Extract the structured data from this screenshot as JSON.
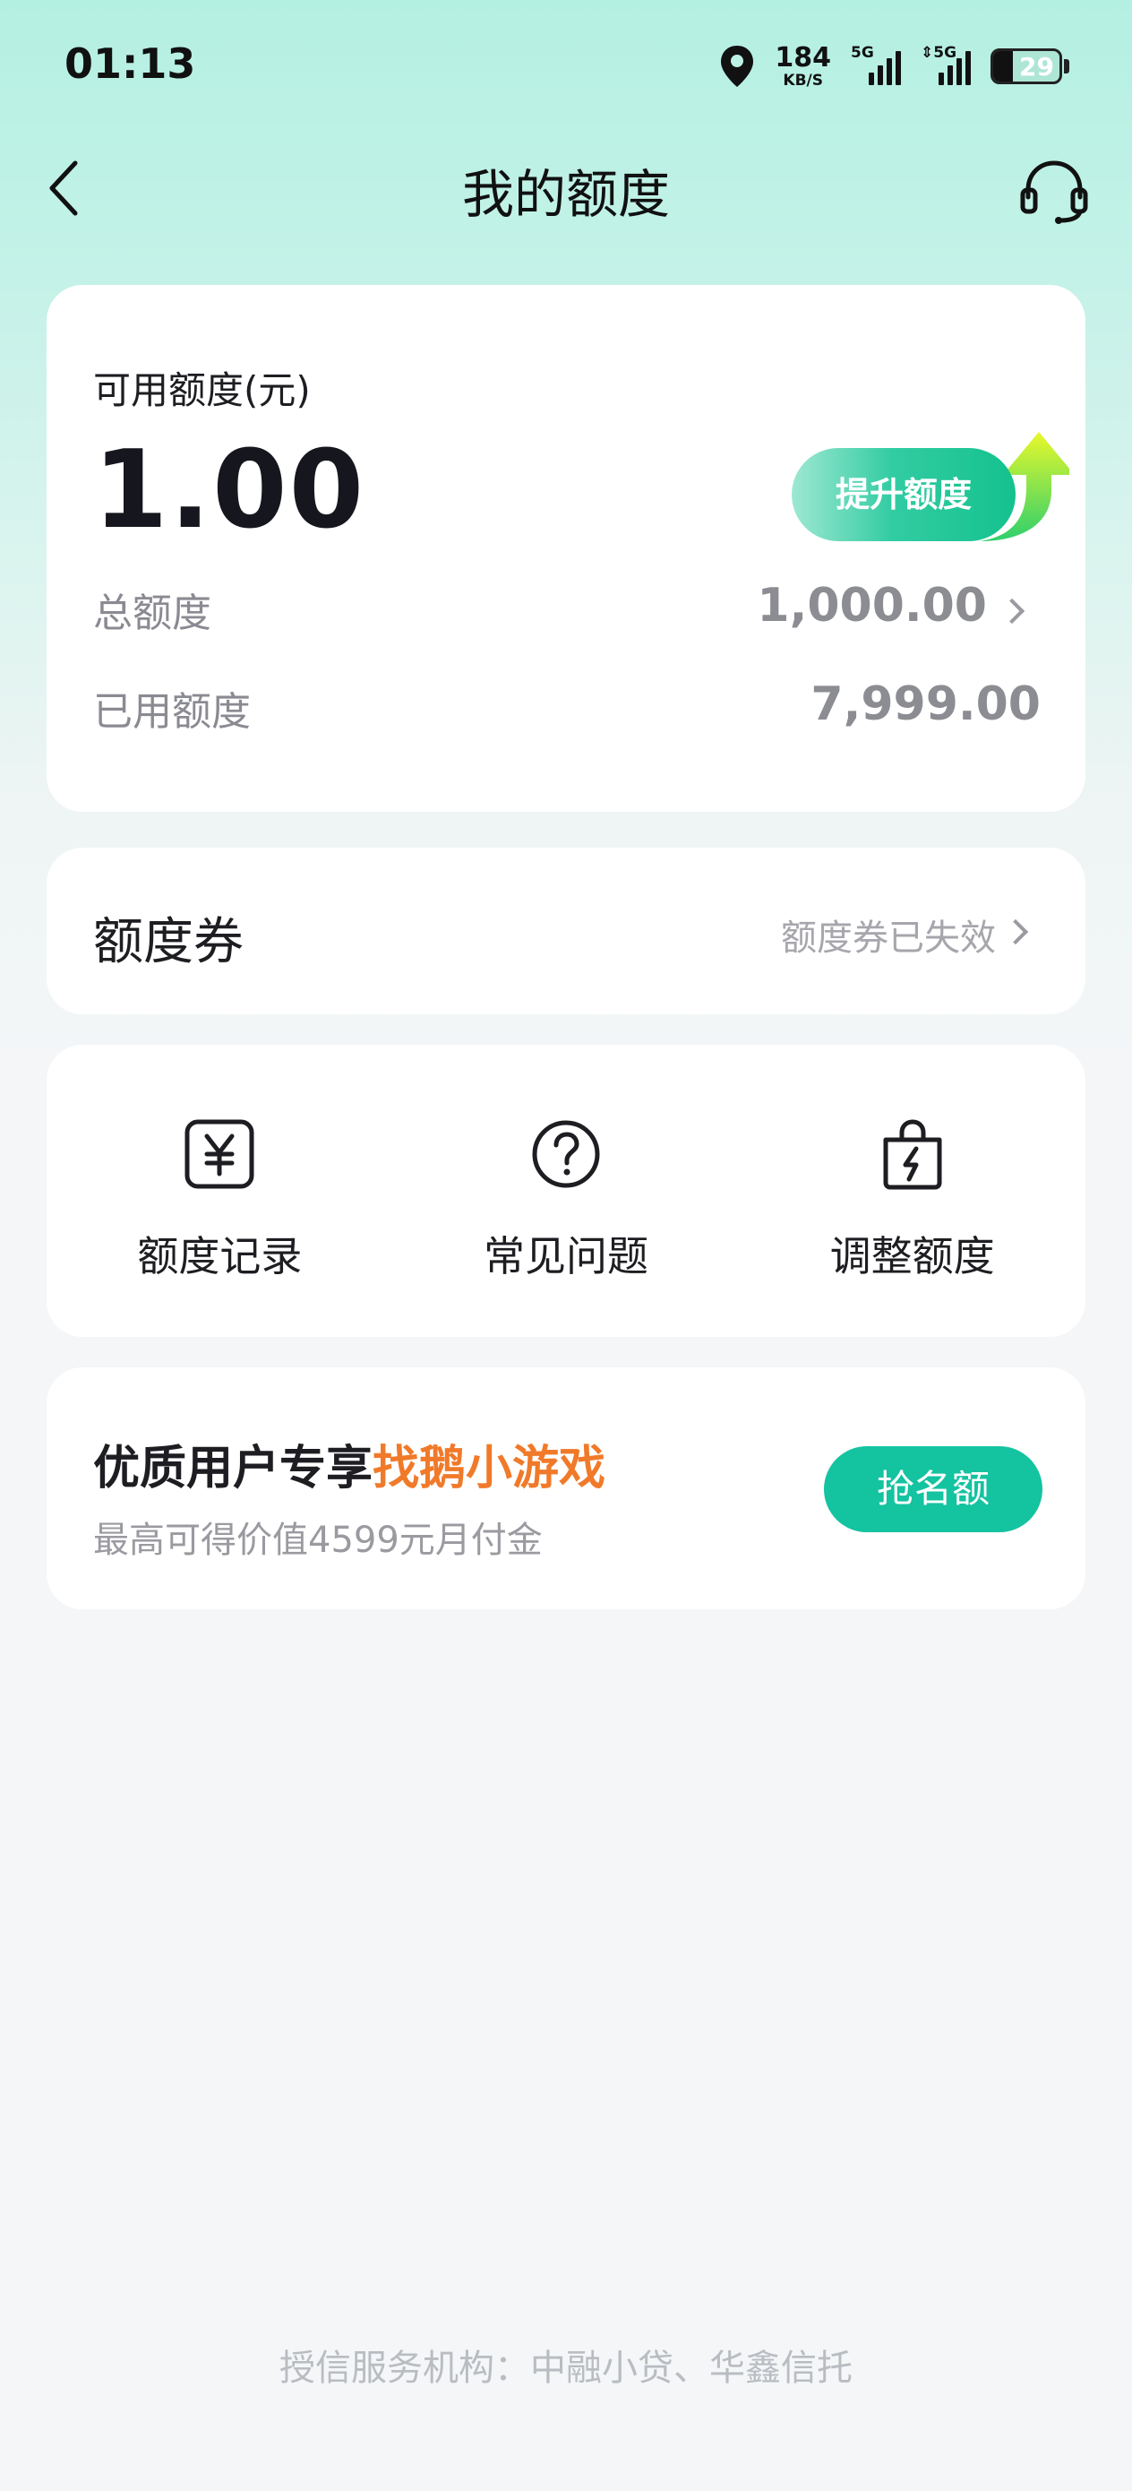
{
  "status_bar": {
    "time": "01:13",
    "net_speed_value": "184",
    "net_speed_unit": "KB/S",
    "sim1_tag": "5G",
    "sim2_tag": "⇕5G",
    "battery_level": "29"
  },
  "nav": {
    "title": "我的额度"
  },
  "quota": {
    "available_label": "可用额度(元)",
    "available_amount": "1.00",
    "raise_label": "提升额度",
    "total_label": "总额度",
    "total_value": "1,000.00",
    "used_label": "已用额度",
    "used_value": "7,999.00"
  },
  "coupon": {
    "title": "额度券",
    "status": "额度券已失效"
  },
  "entries": [
    {
      "label": "额度记录",
      "icon": "yuan-record-icon"
    },
    {
      "label": "常见问题",
      "icon": "question-circle-icon"
    },
    {
      "label": "调整额度",
      "icon": "bag-lightning-icon"
    }
  ],
  "promo": {
    "title_prefix": "优质用户专享",
    "title_highlight": "找鹅小游戏",
    "subtitle": "最高可得价值4599元月付金",
    "button_label": "抢名额"
  },
  "footer": {
    "text": "授信服务机构：中融小贷、华鑫信托"
  },
  "colors": {
    "accent": "#14c3a0",
    "highlight": "#f07a2a",
    "header_bg": "#b4f0e2"
  }
}
